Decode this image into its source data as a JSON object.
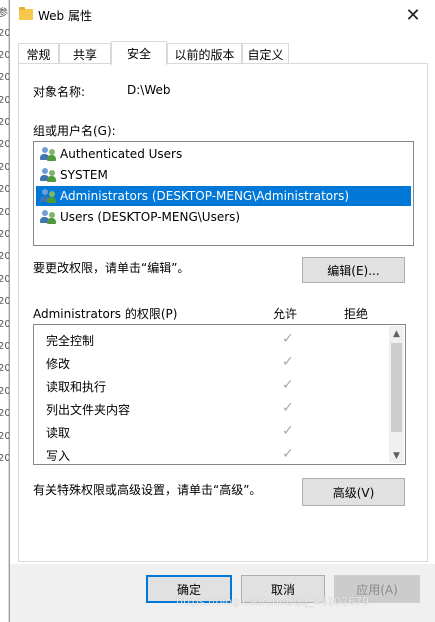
{
  "window": {
    "title": "Web 属性",
    "close_glyph": "✕"
  },
  "background_window": {
    "fragments": [
      "参",
      "20",
      "20",
      "20",
      "20",
      "20",
      "20",
      "20",
      "20",
      "20",
      "20",
      "20",
      "20",
      "20",
      "20",
      "20",
      "20",
      "20",
      "20",
      "20",
      "20",
      "20"
    ]
  },
  "tabs": [
    {
      "label": "常规",
      "active": false
    },
    {
      "label": "共享",
      "active": false
    },
    {
      "label": "安全",
      "active": true
    },
    {
      "label": "以前的版本",
      "active": false
    },
    {
      "label": "自定义",
      "active": false
    }
  ],
  "security": {
    "object_label": "对象名称:",
    "object_value": "D:\\Web",
    "groups_label": "组或用户名(G):",
    "users": [
      {
        "name": "Authenticated Users",
        "selected": false
      },
      {
        "name": "SYSTEM",
        "selected": false
      },
      {
        "name": "Administrators (DESKTOP-MENG\\Administrators)",
        "selected": true
      },
      {
        "name": "Users (DESKTOP-MENG\\Users)",
        "selected": false
      }
    ],
    "edit_hint": "要更改权限，请单击“编辑”。",
    "edit_button": "编辑(E)...",
    "perm_title": "Administrators 的权限(P)",
    "allow_header": "允许",
    "deny_header": "拒绝",
    "permissions": [
      {
        "name": "完全控制",
        "allow": "✓"
      },
      {
        "name": "修改",
        "allow": "✓"
      },
      {
        "name": "读取和执行",
        "allow": "✓"
      },
      {
        "name": "列出文件夹内容",
        "allow": "✓"
      },
      {
        "name": "读取",
        "allow": "✓"
      },
      {
        "name": "写入",
        "allow": "✓"
      }
    ],
    "scroll_up_glyph": "▲",
    "scroll_down_glyph": "▼",
    "advanced_hint": "有关特殊权限或高级设置，请单击“高级”。",
    "advanced_button": "高级(V)"
  },
  "footer": {
    "ok": "确定",
    "cancel": "取消",
    "apply": "应用(A)"
  },
  "watermark": "https://blog.csdn.net/qq_44102679",
  "colors": {
    "selection": "#0078d7",
    "primary_border": "#0078d7"
  }
}
